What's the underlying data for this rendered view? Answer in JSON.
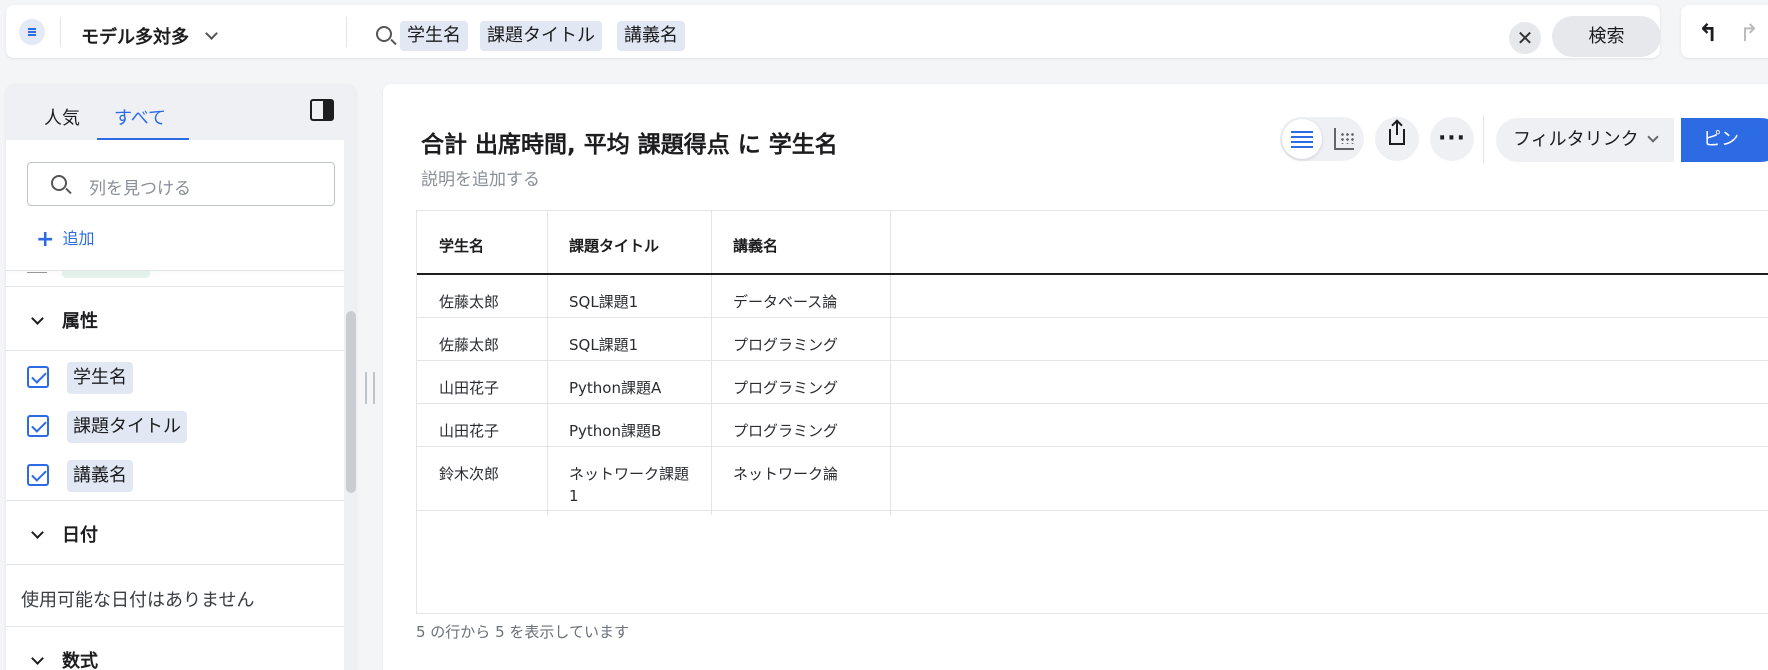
{
  "topbar": {
    "model_title": "モデル多対多",
    "search_chips": [
      "学生名",
      "課題タイトル",
      "講義名"
    ],
    "clear_symbol": "✕",
    "search_button": "検索",
    "undo_symbol": "↰",
    "redo_symbol": "↱"
  },
  "sidebar": {
    "tabs": [
      {
        "label": "人気",
        "active": false
      },
      {
        "label": "すべて",
        "active": true
      }
    ],
    "find_placeholder": "列を見つける",
    "add_label": "追加",
    "sections": {
      "attributes": "属性",
      "dates": "日付",
      "formulas": "数式"
    },
    "attributes": [
      {
        "label": "学生名",
        "checked": true
      },
      {
        "label": "課題タイトル",
        "checked": true
      },
      {
        "label": "講義名",
        "checked": true
      }
    ],
    "no_dates": "使用可能な日付はありません"
  },
  "main": {
    "title": "合計 出席時間, 平均 課題得点 に 学生名",
    "description": "説明を追加する",
    "more_symbol": "···",
    "filter_link": "フィルタリンク",
    "pin_button": "ピン",
    "table": {
      "columns": [
        "学生名",
        "課題タイトル",
        "講義名"
      ],
      "rows": [
        [
          "佐藤太郎",
          "SQL課題1",
          "データベース論"
        ],
        [
          "佐藤太郎",
          "SQL課題1",
          "プログラミング"
        ],
        [
          "山田花子",
          "Python課題A",
          "プログラミング"
        ],
        [
          "山田花子",
          "Python課題B",
          "プログラミング"
        ],
        [
          "鈴木次郎",
          "ネットワーク課題1",
          "ネットワーク論"
        ]
      ]
    },
    "row_count": "5 の行から 5 を表示しています"
  },
  "colors": {
    "accent": "#2d6be4",
    "chip_bg": "#e1e8f4"
  }
}
